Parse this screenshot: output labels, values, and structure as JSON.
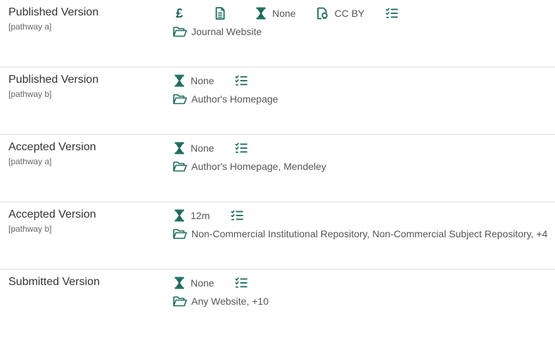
{
  "rows": [
    {
      "title": "Published Version",
      "pathway": "[pathway a]",
      "embargo": "None",
      "license": "CC BY",
      "locations": "Journal Website"
    },
    {
      "title": "Published Version",
      "pathway": "[pathway b]",
      "embargo": "None",
      "locations": "Author's Homepage"
    },
    {
      "title": "Accepted Version",
      "pathway": "[pathway a]",
      "embargo": "None",
      "locations": "Author's Homepage, Mendeley"
    },
    {
      "title": "Accepted Version",
      "pathway": "[pathway b]",
      "embargo": "12m",
      "locations": "Non-Commercial Institutional Repository, Non-Commercial Subject Repository, +4"
    },
    {
      "title": "Submitted Version",
      "pathway": "",
      "embargo": "None",
      "locations": "Any Website, +10"
    }
  ],
  "symbols": {
    "fee": "£"
  },
  "colors": {
    "icon": "#1a6b5a",
    "separator": "#dddddd",
    "title_text": "#333333",
    "value_text": "#555555"
  },
  "icons": {
    "fee": "pound-icon",
    "document": "document-icon",
    "embargo": "hourglass-icon",
    "license": "license-icon",
    "conditions": "checklist-icon",
    "locations": "folder-open-icon"
  }
}
